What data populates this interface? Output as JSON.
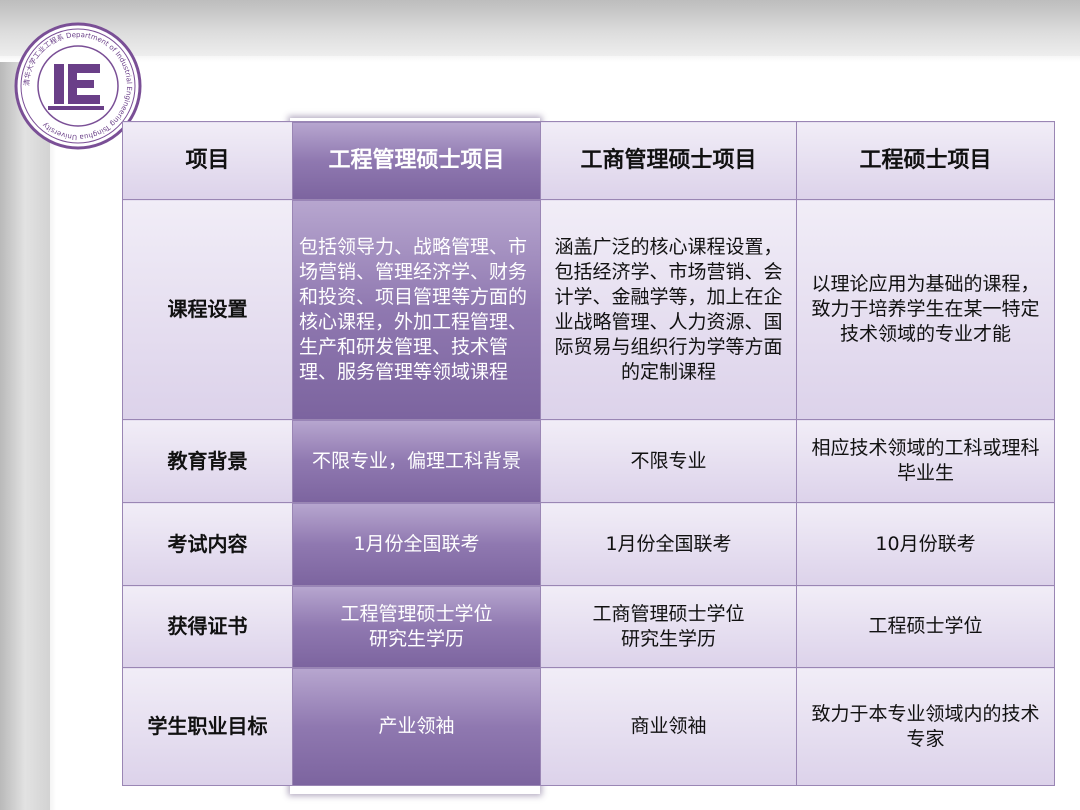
{
  "logo": {
    "text": "清华大学工业工程系 Department of Industrial Engineering Tsinghua University",
    "mark": "IE"
  },
  "table": {
    "headers": [
      "项目",
      "工程管理硕士项目",
      "工商管理硕士项目",
      "工程硕士项目"
    ],
    "rows": [
      {
        "label": "课程设置",
        "cells": [
          "包括领导力、战略管理、市场营销、管理经济学、财务和投资、项目管理等方面的核心课程，外加工程管理、生产和研发管理、技术管理、服务管理等领域课程",
          "涵盖广泛的核心课程设置，包括经济学、市场营销、会计学、金融学等，加上在企业战略管理、人力资源、国际贸易与组织行为学等方面的定制课程",
          "以理论应用为基础的课程，致力于培养学生在某一特定技术领域的专业才能"
        ]
      },
      {
        "label": "教育背景",
        "cells": [
          "不限专业，偏理工科背景",
          "不限专业",
          "相应技术领域的工科或理科毕业生"
        ]
      },
      {
        "label": "考试内容",
        "cells": [
          "1月份全国联考",
          "1月份全国联考",
          "10月份联考"
        ]
      },
      {
        "label": "获得证书",
        "cells": [
          "工程管理硕士学位\n研究生学历",
          "工商管理硕士学位\n研究生学历",
          "工程硕士学位"
        ]
      },
      {
        "label": "学生职业目标",
        "cells": [
          "产业领袖",
          "商业领袖",
          "致力于本专业领域内的技术专家"
        ]
      }
    ]
  },
  "colors": {
    "highlight": "#8f78b0",
    "cell": "#e6dff0",
    "border": "#9a86b4"
  }
}
